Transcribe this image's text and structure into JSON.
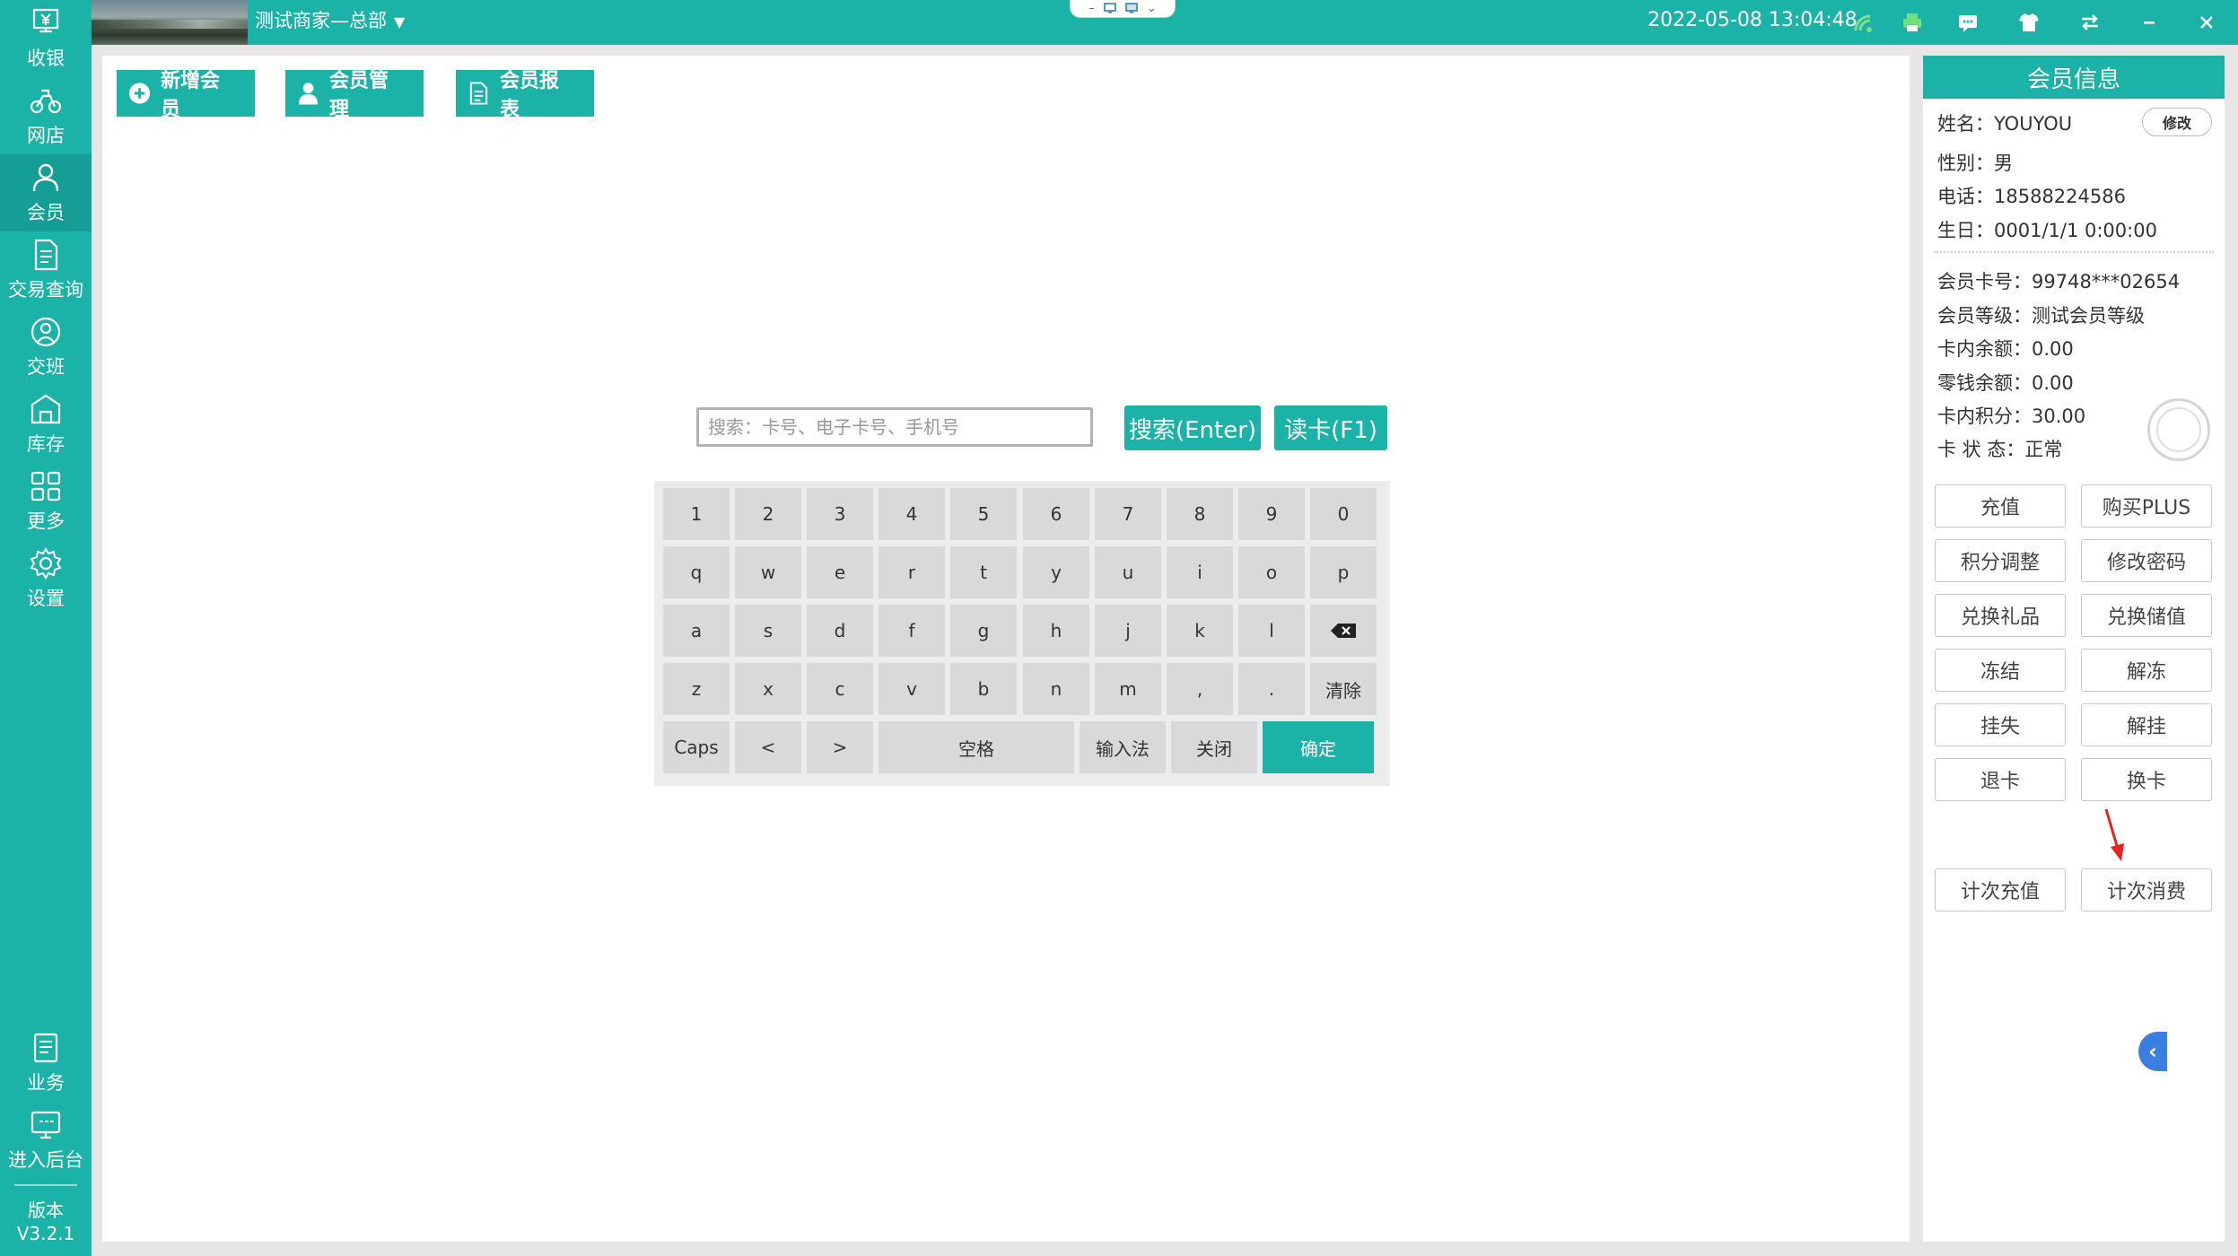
{
  "topbar": {
    "store_name": "测试商家—总部",
    "datetime": "2022-05-08 13:04:48",
    "center_tab_icons": [
      "minus-icon",
      "screen-icon",
      "monitor-icon",
      "chevron-down-icon"
    ],
    "icons": [
      "wifi-signal-icon",
      "printer-icon",
      "message-icon",
      "shirt-icon",
      "swap-icon",
      "minimize-icon",
      "close-icon"
    ]
  },
  "nav": {
    "items": [
      {
        "label": "收银",
        "icon": "cashier-icon"
      },
      {
        "label": "网店",
        "icon": "bike-icon"
      },
      {
        "label": "会员",
        "icon": "person-icon"
      },
      {
        "label": "交易查询",
        "icon": "document-icon"
      },
      {
        "label": "交班",
        "icon": "user-shift-icon"
      },
      {
        "label": "库存",
        "icon": "warehouse-icon"
      },
      {
        "label": "更多",
        "icon": "grid-icon"
      },
      {
        "label": "设置",
        "icon": "gear-icon"
      }
    ],
    "bottom_items": [
      {
        "label": "业务",
        "icon": "book-icon"
      },
      {
        "label": "进入后台",
        "icon": "monitor-icon"
      }
    ],
    "version_label": "版本",
    "version_value": "V3.2.1"
  },
  "toolbar": {
    "add_member": "新增会员",
    "member_manage": "会员管理",
    "member_report": "会员报表"
  },
  "search": {
    "placeholder": "搜索：卡号、电子卡号、手机号",
    "search_button": "搜索(Enter)",
    "read_card_button": "读卡(F1)"
  },
  "keyboard": {
    "row1": [
      "1",
      "2",
      "3",
      "4",
      "5",
      "6",
      "7",
      "8",
      "9",
      "0"
    ],
    "row2": [
      "q",
      "w",
      "e",
      "r",
      "t",
      "y",
      "u",
      "i",
      "o",
      "p"
    ],
    "row3": [
      "a",
      "s",
      "d",
      "f",
      "g",
      "h",
      "j",
      "k",
      "l"
    ],
    "row4": [
      "z",
      "x",
      "c",
      "v",
      "b",
      "n",
      "m",
      ",",
      "."
    ],
    "clear": "清除",
    "caps": "Caps",
    "lt": "<",
    "gt": ">",
    "space": "空格",
    "ime": "输入法",
    "close": "关闭",
    "confirm": "确定"
  },
  "member": {
    "title": "会员信息",
    "edit_button": "修改",
    "name": "姓名：YOUYOU",
    "gender": "性别：男",
    "phone": "电话：18588224586",
    "birthday": "生日：0001/1/1 0:00:00",
    "card_no": "会员卡号：99748***02654",
    "level": "会员等级：测试会员等级",
    "card_balance": "卡内余额：0.00",
    "change_balance": "零钱余额：0.00",
    "points": "卡内积分：30.00",
    "status": "卡 状 态：正常",
    "actions": [
      "充值",
      "购买PLUS",
      "积分调整",
      "修改密码",
      "兑换礼品",
      "兑换储值",
      "冻结",
      "解冻",
      "挂失",
      "解挂",
      "退卡",
      "换卡"
    ],
    "count_recharge": "计次充值",
    "count_consume": "计次消费",
    "arrow_color": "#e8231f"
  },
  "colors": {
    "accent": "#1bb3a8",
    "collapse_button": "#3a7fe0"
  }
}
